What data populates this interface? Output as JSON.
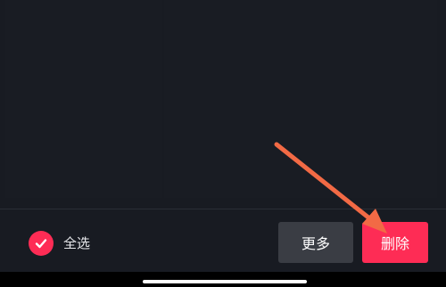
{
  "colors": {
    "accent": "#fe2c55",
    "arrow": "#f26a45",
    "background": "#181b22"
  },
  "footer": {
    "select_all_label": "全选",
    "more_button_label": "更多",
    "delete_button_label": "删除",
    "select_all_checked": true
  },
  "icons": {
    "select_all": "check-icon",
    "annotation": "arrow-icon"
  }
}
